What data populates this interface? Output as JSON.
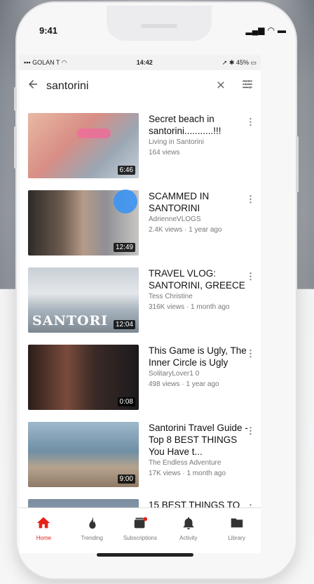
{
  "device": {
    "time": "9:41"
  },
  "status": {
    "carrier": "GOLAN T",
    "time": "14:42",
    "battery": "45%"
  },
  "search": {
    "query": "santorini"
  },
  "videos": [
    {
      "title": "Secret beach in santorini...........!!!",
      "channel": "Living in Santorini",
      "stats": "164 views",
      "duration": "6:46"
    },
    {
      "title": "SCAMMED IN SANTORINI",
      "channel": "AdrienneVLOGS",
      "stats": "2.4K views · 1 year ago",
      "duration": "12:49"
    },
    {
      "title": "TRAVEL VLOG: SANTORINI, GREECE",
      "channel": "Tess Christine",
      "stats": "316K views · 1 month ago",
      "duration": "12:04",
      "overlay": "SANTORI"
    },
    {
      "title": "This Game is Ugly, The Inner Circle is Ugly",
      "channel": "SolitaryLover1 0",
      "stats": "498 views · 1 year ago",
      "duration": "0:08"
    },
    {
      "title": "Santorini Travel Guide - Top 8 BEST THINGS You Have t...",
      "channel": "The Endless Adventure",
      "stats": "17K views · 1 month ago",
      "duration": "9:00"
    },
    {
      "title": "15 BEST THINGS TO",
      "channel": "",
      "stats": "",
      "duration": ""
    }
  ],
  "nav": [
    {
      "label": "Home",
      "icon": "home-icon",
      "active": true
    },
    {
      "label": "Trending",
      "icon": "flame-icon"
    },
    {
      "label": "Subscriptions",
      "icon": "subscriptions-icon"
    },
    {
      "label": "Activity",
      "icon": "bell-icon"
    },
    {
      "label": "Library",
      "icon": "folder-icon"
    }
  ],
  "colors": {
    "accent": "#e62117",
    "touch": "#3b93f3"
  }
}
